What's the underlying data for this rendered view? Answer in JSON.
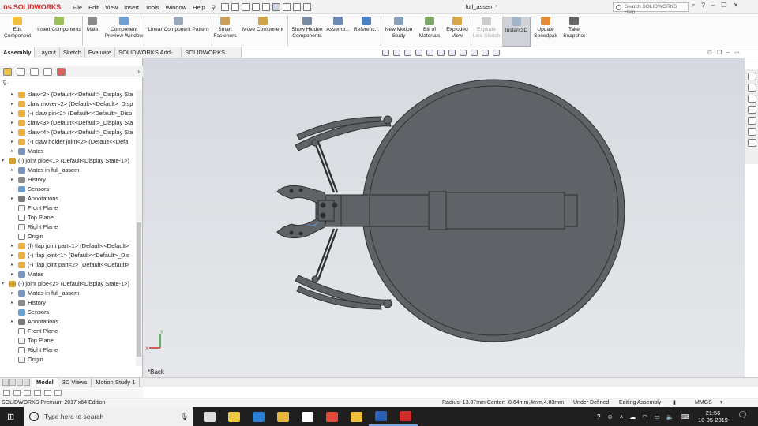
{
  "app": {
    "brand": "SOLIDWORKS",
    "document_title": "full_assem *",
    "menu": [
      "File",
      "Edit",
      "View",
      "Insert",
      "Tools",
      "Window",
      "Help"
    ],
    "search_placeholder": "Search SOLIDWORKS Help"
  },
  "ribbon": [
    {
      "label1": "Edit",
      "label2": "Component",
      "color": "#f0c040",
      "icon": "edit-component-icon"
    },
    {
      "label1": "Insert Components",
      "label2": "",
      "color": "#9cbf5a",
      "icon": "insert-components-icon"
    },
    {
      "label1": "Mate",
      "label2": "",
      "color": "#8a8a8a",
      "icon": "mate-icon"
    },
    {
      "label1": "Component",
      "label2": "Preview Window",
      "color": "#6fa0d0",
      "icon": "component-preview-icon"
    },
    {
      "label1": "Linear Component Pattern",
      "label2": "",
      "color": "#9aa9b9",
      "icon": "linear-pattern-icon"
    },
    {
      "label1": "Smart",
      "label2": "Fasteners",
      "color": "#c9a05a",
      "icon": "smart-fasteners-icon"
    },
    {
      "label1": "Move Component",
      "label2": "",
      "color": "#d0a44b",
      "icon": "move-component-icon"
    },
    {
      "label1": "Show Hidden",
      "label2": "Components",
      "color": "#7a8aa0",
      "icon": "show-hidden-icon"
    },
    {
      "label1": "Assemb...",
      "label2": "",
      "color": "#6b89b5",
      "icon": "assembly-features-icon"
    },
    {
      "label1": "Referenc...",
      "label2": "",
      "color": "#4b7fc0",
      "icon": "reference-geometry-icon"
    },
    {
      "label1": "New Motion",
      "label2": "Study",
      "color": "#8aa0b8",
      "icon": "motion-study-icon"
    },
    {
      "label1": "Bill of",
      "label2": "Materials",
      "color": "#7fa66a",
      "icon": "bom-icon"
    },
    {
      "label1": "Exploded",
      "label2": "View",
      "color": "#d6a84a",
      "icon": "exploded-view-icon"
    },
    {
      "label1": "Explode",
      "label2": "Line Sketch",
      "color": "#cccccc",
      "icon": "explode-line-icon",
      "disabled": true
    },
    {
      "label1": "Instant3D",
      "label2": "",
      "color": "#a0b4c8",
      "icon": "instant3d-icon",
      "active": true
    },
    {
      "label1": "Update",
      "label2": "Speedpak",
      "color": "#e08c3a",
      "icon": "speedpak-icon"
    },
    {
      "label1": "Take",
      "label2": "Snapshot",
      "color": "#666666",
      "icon": "snapshot-icon"
    }
  ],
  "tabs": [
    "Assembly",
    "Layout",
    "Sketch",
    "Evaluate",
    "SOLIDWORKS Add-Ins",
    "SOLIDWORKS MBD"
  ],
  "tree": [
    {
      "label": "claw<2> (Default<<Default>_Display Sta",
      "level": 1,
      "icon": "part",
      "exp": "▸"
    },
    {
      "label": "claw mover<2> (Default<<Default>_Disp",
      "level": 1,
      "icon": "part",
      "exp": "▸"
    },
    {
      "label": "(-) claw pin<2> (Default<<Default>_Disp",
      "level": 1,
      "icon": "part",
      "exp": "▸"
    },
    {
      "label": "claw<3> (Default<<Default>_Display Sta",
      "level": 1,
      "icon": "part",
      "exp": "▸"
    },
    {
      "label": "claw<4> (Default<<Default>_Display Sta",
      "level": 1,
      "icon": "part",
      "exp": "▸"
    },
    {
      "label": "(-) claw holder joint<2> (Default<<Defa",
      "level": 1,
      "icon": "part",
      "exp": "▸"
    },
    {
      "label": "Mates",
      "level": 1,
      "icon": "mates",
      "exp": "▸"
    },
    {
      "label": "(-) joint pipe<1> (Default<Display State-1>)",
      "level": 0,
      "icon": "subassem",
      "exp": "▾"
    },
    {
      "label": "Mates in full_assem",
      "level": 1,
      "icon": "mates",
      "exp": "▸"
    },
    {
      "label": "History",
      "level": 1,
      "icon": "history",
      "exp": "▸"
    },
    {
      "label": "Sensors",
      "level": 1,
      "icon": "sensor",
      "exp": ""
    },
    {
      "label": "Annotations",
      "level": 1,
      "icon": "annot",
      "exp": "▸"
    },
    {
      "label": "Front Plane",
      "level": 1,
      "icon": "plane",
      "exp": ""
    },
    {
      "label": "Top Plane",
      "level": 1,
      "icon": "plane",
      "exp": ""
    },
    {
      "label": "Right Plane",
      "level": 1,
      "icon": "plane",
      "exp": ""
    },
    {
      "label": "Origin",
      "level": 1,
      "icon": "origin",
      "exp": ""
    },
    {
      "label": "(f) flap joint part<1> (Default<<Default>",
      "level": 1,
      "icon": "part",
      "exp": "▸"
    },
    {
      "label": "(-) flap joint<1> (Default<<Default>_Dis",
      "level": 1,
      "icon": "part",
      "exp": "▸"
    },
    {
      "label": "(-) flap joint part<2> (Default<<Default>",
      "level": 1,
      "icon": "part",
      "exp": "▸"
    },
    {
      "label": "Mates",
      "level": 1,
      "icon": "mates",
      "exp": "▸"
    },
    {
      "label": "(-) joint pipe<2> (Default<Display State-1>)",
      "level": 0,
      "icon": "subassem",
      "exp": "▾"
    },
    {
      "label": "Mates in full_assem",
      "level": 1,
      "icon": "mates",
      "exp": "▸"
    },
    {
      "label": "History",
      "level": 1,
      "icon": "history",
      "exp": "▸"
    },
    {
      "label": "Sensors",
      "level": 1,
      "icon": "sensor",
      "exp": ""
    },
    {
      "label": "Annotations",
      "level": 1,
      "icon": "annot",
      "exp": "▸"
    },
    {
      "label": "Front Plane",
      "level": 1,
      "icon": "plane",
      "exp": ""
    },
    {
      "label": "Top Plane",
      "level": 1,
      "icon": "plane",
      "exp": ""
    },
    {
      "label": "Right Plane",
      "level": 1,
      "icon": "plane",
      "exp": ""
    },
    {
      "label": "Origin",
      "level": 1,
      "icon": "origin",
      "exp": ""
    }
  ],
  "viewport": {
    "back_label": "*Back",
    "triad_x": "X",
    "triad_y": "Y"
  },
  "bottom_tabs": [
    "Model",
    "3D Views",
    "Motion Study 1"
  ],
  "status": {
    "edition": "SOLIDWORKS Premium 2017 x64 Edition",
    "measure": "Radius: 13.37mm  Center: -8.64mm,4mm,4.83mm",
    "state": "Under Defined",
    "mode": "Editing Assembly",
    "units": "MMGS"
  },
  "taskbar": {
    "search_placeholder": "Type here to search",
    "time": "21:56",
    "date": "10-05-2019",
    "apps": [
      {
        "name": "task-view",
        "color": "#dddddd"
      },
      {
        "name": "store",
        "color": "#f2c744"
      },
      {
        "name": "edge",
        "color": "#2a7fd4"
      },
      {
        "name": "file-explorer",
        "color": "#e8b63c"
      },
      {
        "name": "mail",
        "color": "#ffffff"
      },
      {
        "name": "chrome",
        "color": "#e04b3a"
      },
      {
        "name": "photos",
        "color": "#f0c040"
      },
      {
        "name": "word",
        "color": "#2b5fb3"
      },
      {
        "name": "solidworks",
        "color": "#d12b2b"
      }
    ]
  },
  "colors": {
    "part_body": "#5f6266",
    "part_edge": "#2e3033",
    "highlight": "#5b9bd5",
    "solidworks_red": "#d12b2b"
  }
}
